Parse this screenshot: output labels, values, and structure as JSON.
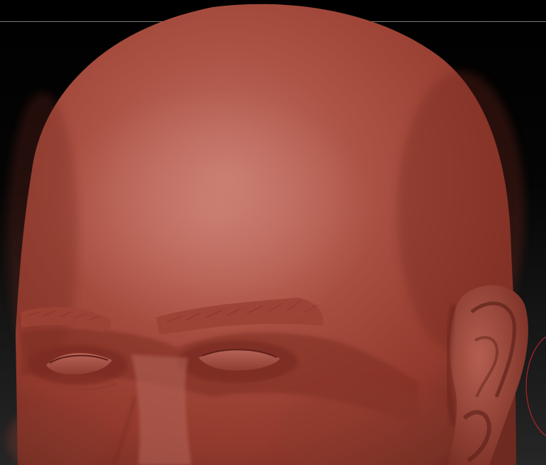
{
  "viewport": {
    "background_top": "#000000",
    "background_bottom": "#262626",
    "frame_line_color": "#7a7a7a"
  },
  "mesh": {
    "subject": "head-sculpt",
    "material_color": "#a5473a",
    "highlight_color": "#c8766a",
    "shadow_color": "#5a1f17"
  },
  "brush_cursor": {
    "color": "#b0242a"
  }
}
